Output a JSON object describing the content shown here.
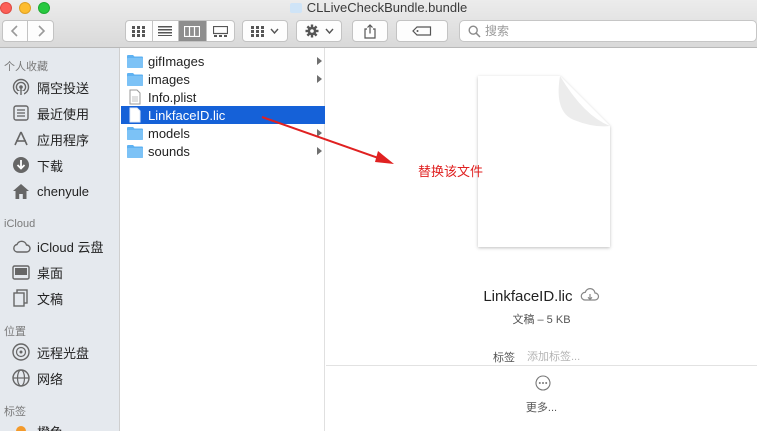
{
  "window": {
    "title": "CLLiveCheckBundle.bundle"
  },
  "search": {
    "placeholder": "搜索"
  },
  "sidebar": {
    "sections": [
      {
        "header": "个人收藏",
        "items": [
          {
            "label": "隔空投送",
            "icon": "airdrop-icon"
          },
          {
            "label": "最近使用",
            "icon": "recents-icon"
          },
          {
            "label": "应用程序",
            "icon": "applications-icon"
          },
          {
            "label": "下载",
            "icon": "download-icon"
          },
          {
            "label": "chenyule",
            "icon": "home-icon"
          }
        ]
      },
      {
        "header": "iCloud",
        "items": [
          {
            "label": "iCloud 云盘",
            "icon": "cloud-icon"
          },
          {
            "label": "桌面",
            "icon": "desktop-icon"
          },
          {
            "label": "文稿",
            "icon": "documents-icon"
          }
        ]
      },
      {
        "header": "位置",
        "items": [
          {
            "label": "远程光盘",
            "icon": "disc-icon"
          },
          {
            "label": "网络",
            "icon": "network-icon"
          }
        ]
      },
      {
        "header": "标签",
        "items": [
          {
            "label": "橙色",
            "icon": "orange-tag-icon"
          }
        ]
      }
    ]
  },
  "files": [
    {
      "name": "gifImages",
      "kind": "folder",
      "has_children": true
    },
    {
      "name": "images",
      "kind": "folder",
      "has_children": true
    },
    {
      "name": "Info.plist",
      "kind": "file",
      "has_children": false
    },
    {
      "name": "LinkfaceID.lic",
      "kind": "file",
      "has_children": false,
      "selected": true
    },
    {
      "name": "models",
      "kind": "folder",
      "has_children": true
    },
    {
      "name": "sounds",
      "kind": "folder",
      "has_children": true
    }
  ],
  "preview": {
    "file_name": "LinkfaceID.lic",
    "info": "文稿 – 5 KB",
    "tags_label": "标签",
    "tags_placeholder": "添加标签...",
    "more_label": "更多..."
  },
  "annotation": {
    "text": "替换该文件",
    "color": "#e02121"
  },
  "colors": {
    "selection": "#1561d8",
    "sidebar_bg": "#e5e9ee",
    "folder": "#5fb2f2"
  }
}
